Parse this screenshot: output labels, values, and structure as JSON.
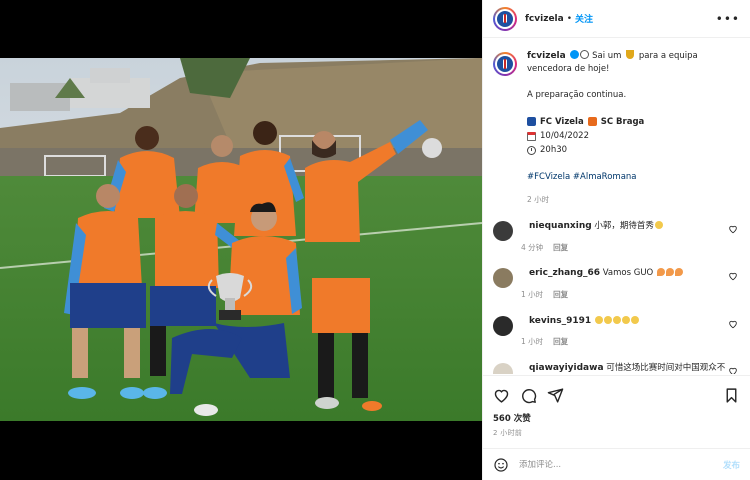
{
  "header": {
    "username": "fcvizela",
    "separator": "•",
    "follow_label": "关注",
    "more_label": "•••"
  },
  "caption": {
    "username": "fcvizela",
    "text_part1": "Sai um",
    "text_part2": "para a equipa vencedora de hoje!",
    "paragraph2": "A preparação continua.",
    "match_home": "FC Vizela",
    "match_away": "SC Braga",
    "date": "10/04/2022",
    "time": "20h30",
    "hashtags": "#FCVizela #AlmaRomana",
    "posted_ago": "2 小时"
  },
  "comments": [
    {
      "username": "niequanxing",
      "text": "小郭，期待首秀",
      "emoji": "clap",
      "emoji_count": 1,
      "age": "4 分钟",
      "reply_label": "回复",
      "avatar_color": "#3b3b3b"
    },
    {
      "username": "eric_zhang_66",
      "text": "Vamos GUO",
      "emoji": "fire",
      "emoji_count": 3,
      "age": "1 小时",
      "reply_label": "回复",
      "avatar_color": "#8a7b60"
    },
    {
      "username": "kevins_9191",
      "text": "",
      "emoji": "clap",
      "emoji_count": 5,
      "age": "1 小时",
      "reply_label": "回复",
      "avatar_color": "#2a2a2a"
    },
    {
      "username": "qiawayiyidawa",
      "text": "可惜这场比赛时间对中国观众不",
      "emoji": "",
      "emoji_count": 0,
      "age": "",
      "reply_label": "",
      "avatar_color": "#d9d2c5"
    }
  ],
  "actions": {
    "likes": "560 次赞",
    "posted_ago": "2 小时前"
  },
  "add_comment": {
    "placeholder": "添加评论...",
    "post_label": "发布"
  },
  "colors": {
    "accent": "#0095f6",
    "link": "#00376b",
    "muted": "#8e8e8e",
    "jersey_orange": "#f07a2a",
    "jersey_blue": "#3f8fd6"
  }
}
